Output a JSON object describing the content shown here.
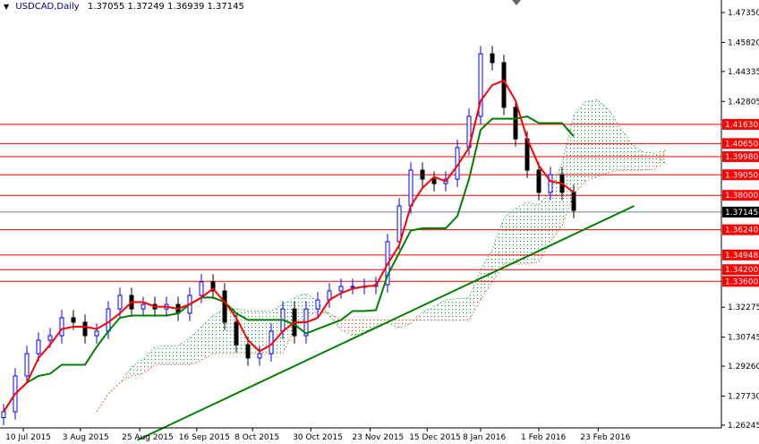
{
  "header": {
    "symbol": "USDCAD,Daily",
    "ohlc": "1.37055 1.37249 1.36939 1.37145"
  },
  "colors": {
    "bull": "#0000ff",
    "bear": "#000000",
    "tenkan": "#ff0000",
    "kijun": "#008000",
    "cloud_up": "#00a040",
    "cloud_down": "#ff3000",
    "level": "#ff0000",
    "trend": "#008000",
    "current": "#708090"
  },
  "chart_data": {
    "type": "line",
    "title": "USDCAD,Daily",
    "ylim": [
      1.26245,
      1.4735
    ],
    "y_ticks": [
      "1.47350",
      "1.45820",
      "1.44335",
      "1.42805",
      "1.32275",
      "1.30745",
      "1.29260",
      "1.27730",
      "1.26245"
    ],
    "x_labels": [
      {
        "i": 1.7,
        "label": "10 Jul 2015"
      },
      {
        "i": 6.6,
        "label": "3 Aug 2015"
      },
      {
        "i": 11.7,
        "label": "25 Aug 2015"
      },
      {
        "i": 16.6,
        "label": "16 Sep 2015"
      },
      {
        "i": 21.4,
        "label": "8 Oct 2015"
      },
      {
        "i": 26.4,
        "label": "30 Oct 2015"
      },
      {
        "i": 31.5,
        "label": "23 Nov 2015"
      },
      {
        "i": 36.4,
        "label": "15 Dec 2015"
      },
      {
        "i": 41,
        "label": "8 Jan 2016"
      },
      {
        "i": 46,
        "label": "1 Feb 2016"
      },
      {
        "i": 51.1,
        "label": "23 Feb 2016"
      }
    ],
    "close": [
      1.2693,
      1.2876,
      1.299,
      1.3059,
      1.3082,
      1.3174,
      1.3151,
      1.3082,
      1.3105,
      1.3219,
      1.3288,
      1.3219,
      1.3242,
      1.3219,
      1.3242,
      1.3197,
      1.3288,
      1.3357,
      1.3311,
      1.3151,
      1.3036,
      1.2968,
      1.299,
      1.3105,
      1.3219,
      1.3082,
      1.3219,
      1.3265,
      1.3311,
      1.3334,
      1.3334,
      1.3334,
      1.3343,
      1.3563,
      1.3746,
      1.3929,
      1.3883,
      1.386,
      1.3883,
      1.4044,
      1.4204,
      1.4524,
      1.4479,
      1.425,
      1.4089,
      1.3929,
      1.3815,
      1.3906,
      1.3815,
      1.3723
    ],
    "levels": [
      {
        "price": 1.4163,
        "label": "1.41630"
      },
      {
        "price": 1.4065,
        "label": "1.40650"
      },
      {
        "price": 1.3998,
        "label": "1.39980"
      },
      {
        "price": 1.3905,
        "label": "1.39050"
      },
      {
        "price": 1.38,
        "label": "1.38000"
      },
      {
        "price": 1.3624,
        "label": "1.36240"
      },
      {
        "price": 1.34948,
        "label": "1.34948"
      },
      {
        "price": 1.342,
        "label": "1.34200"
      },
      {
        "price": 1.336,
        "label": "1.33600"
      }
    ],
    "current": {
      "price": 1.37145,
      "label": "1.37145"
    },
    "trendline": [
      {
        "i": 11.5,
        "price": 1.2548
      },
      {
        "i": 54.2,
        "price": 1.3746
      }
    ]
  }
}
